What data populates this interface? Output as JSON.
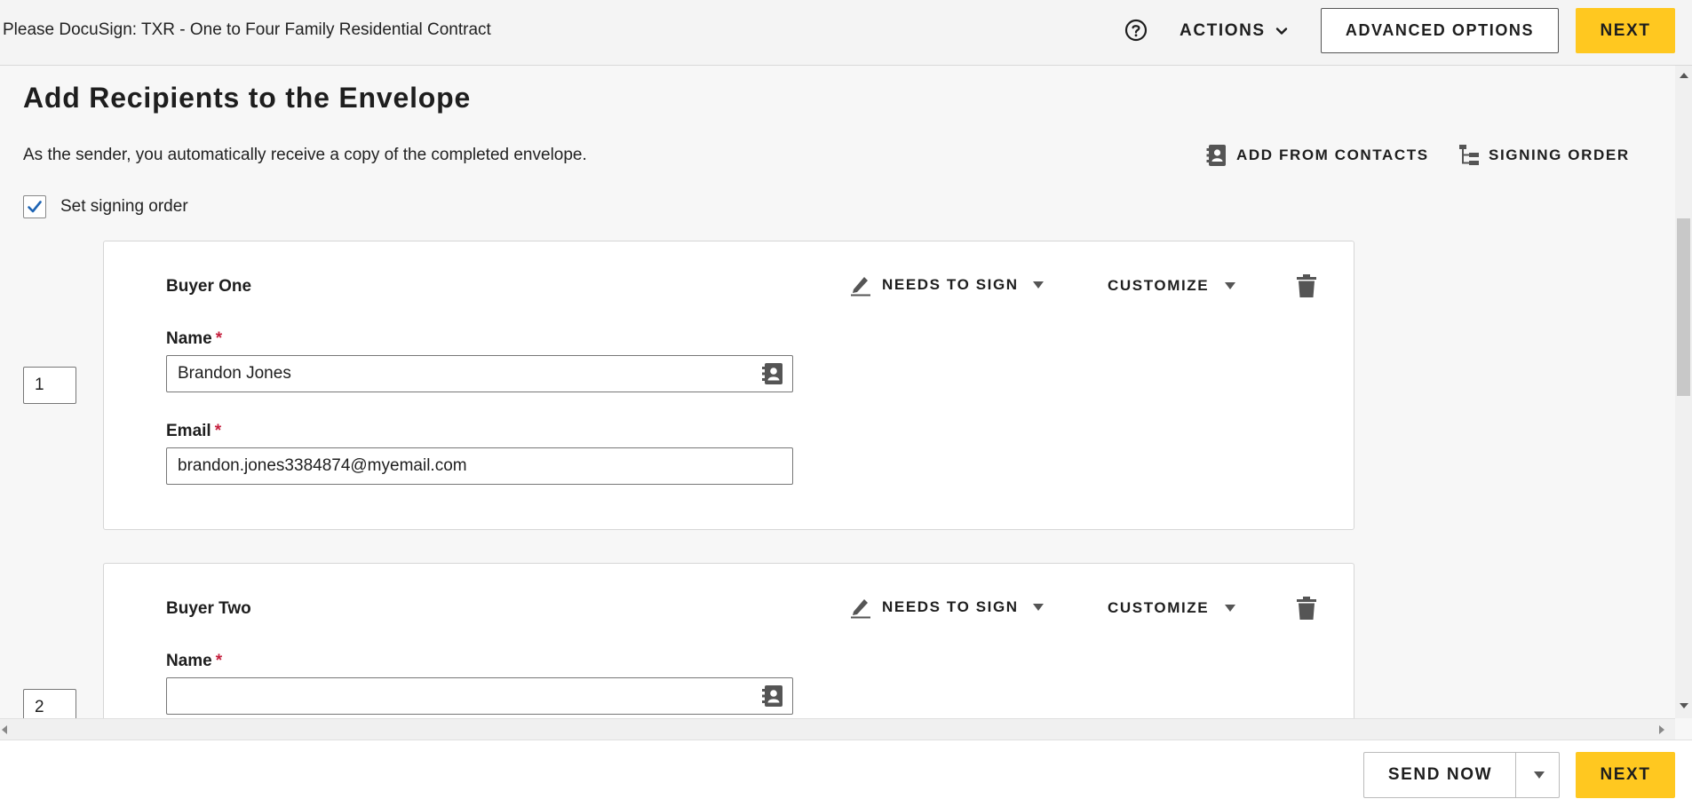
{
  "header": {
    "doc_title": "Please DocuSign: TXR - One to Four Family Residential Contract",
    "help_icon": "question-circle-icon",
    "actions_label": "ACTIONS",
    "advanced_options_label": "ADVANCED OPTIONS",
    "next_label": "NEXT"
  },
  "main": {
    "title": "Add Recipients to the Envelope",
    "sender_note": "As the sender, you automatically receive a copy of the completed envelope.",
    "add_from_contacts_label": "ADD FROM CONTACTS",
    "signing_order_label": "SIGNING ORDER",
    "set_signing_order": {
      "label": "Set signing order",
      "checked": true
    },
    "recipients": [
      {
        "order": "1",
        "role_name": "Buyer One",
        "action_label": "NEEDS TO SIGN",
        "customize_label": "CUSTOMIZE",
        "name_label": "Name",
        "name_value": "Brandon Jones",
        "email_label": "Email",
        "email_value": "brandon.jones3384874@myemail.com"
      },
      {
        "order": "2",
        "role_name": "Buyer Two",
        "action_label": "NEEDS TO SIGN",
        "customize_label": "CUSTOMIZE",
        "name_label": "Name",
        "name_value": ""
      }
    ]
  },
  "footer": {
    "send_now_label": "SEND NOW",
    "next_label": "NEXT"
  },
  "colors": {
    "accent_yellow": "#ffc820",
    "required_red": "#c5203e",
    "checkbox_blue": "#1e64b4"
  }
}
